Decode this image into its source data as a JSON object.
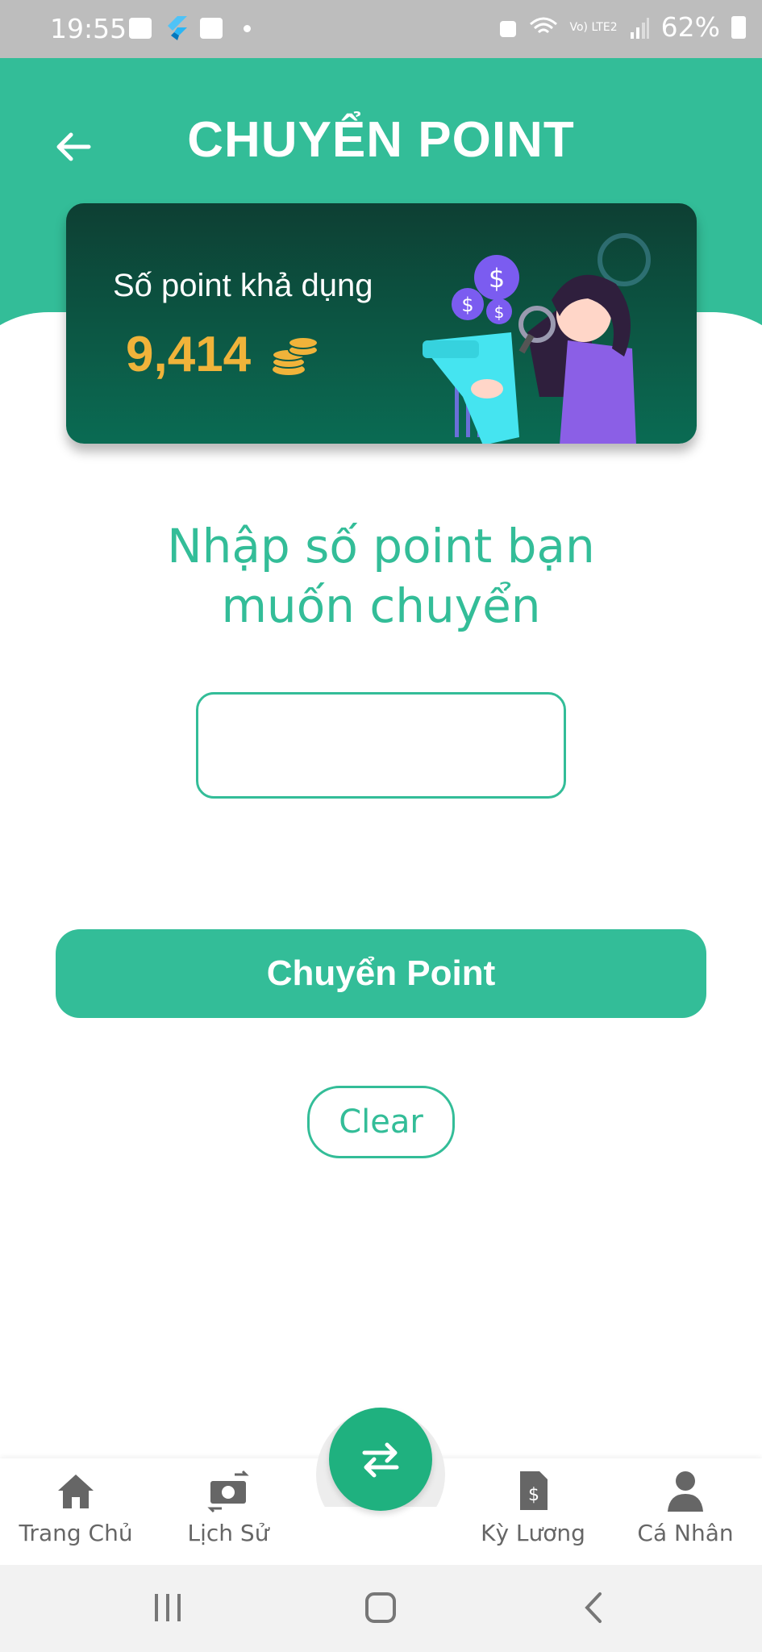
{
  "status_bar": {
    "time": "19:55",
    "battery": "62%",
    "network": "Vo) LTE2"
  },
  "header": {
    "title": "CHUYỂN POINT"
  },
  "balance_card": {
    "label": "Số point khả dụng",
    "balance": "9,414"
  },
  "transfer": {
    "prompt_line1": "Nhập số point bạn",
    "prompt_line2": "muốn chuyển",
    "input_value": "",
    "submit_label": "Chuyển Point",
    "clear_label": "Clear"
  },
  "bottom_nav": {
    "items": [
      {
        "label": "Trang Chủ",
        "icon": "home-icon"
      },
      {
        "label": "Lịch Sử",
        "icon": "money-history-icon"
      },
      {
        "label": "Kỳ Lương",
        "icon": "payslip-icon"
      },
      {
        "label": "Cá Nhân",
        "icon": "person-icon"
      }
    ],
    "fab_icon": "swap-arrows-icon"
  },
  "colors": {
    "primary": "#33bd98",
    "card_dark": "#0c5a46",
    "balance_gold": "#f0b33a",
    "fab": "#1fb17f"
  }
}
